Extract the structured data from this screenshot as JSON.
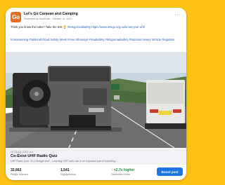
{
  "post": {
    "logo_text": "Go",
    "page_name": "Let's Go Caravan and Camping",
    "meta": "Published by HootSuite  ·  October 14, 2021  ·",
    "more_label": "···",
    "text_before": "Think you know the rules? Take the test ",
    "trophy_emoji": "🏆",
    "text_link": " #letsgoroadsafety https://www.letsgo.org.au/know-your-uhf/",
    "hashtags": "#caravanning #National Road Safety Week #rvse #drivesys #roadsafety #letsgoroadsafety #National Heavy Vehicle Regulator"
  },
  "link_preview": {
    "domain": "LETSGO.ORG.AU",
    "title": "Co-Exist UHF Radio Quiz",
    "description": "UHF Radio Quiz \"10-4 Budget trial\" - Learning UHF radio use is an important part of travelling ..."
  },
  "stats": {
    "reach_value": "32,662",
    "reach_label": "People reached",
    "engagement_value": "1,541",
    "engagement_label": "Engagements",
    "score_value": "↑ +2.7x higher",
    "score_label": "Distribution score",
    "boost_label": "Boost post"
  },
  "photo": {
    "plate_text": "KAR TRACK"
  },
  "colors": {
    "background": "#ffc316",
    "brand_orange": "#ec6c1f",
    "link_blue": "#2a5fb0",
    "boost_blue": "#1b74e4",
    "positive_green": "#1f8a3b"
  }
}
